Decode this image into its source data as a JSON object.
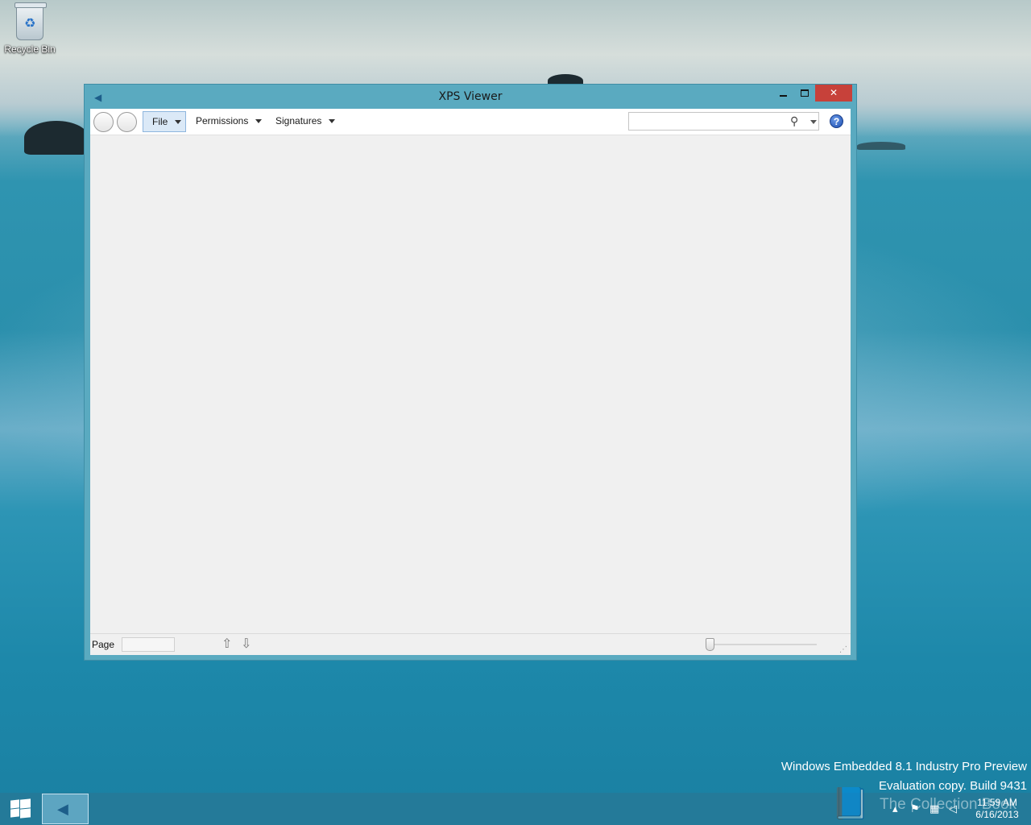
{
  "desktop": {
    "icons": [
      {
        "label": "Recycle Bin",
        "icon": "recycle-bin-icon"
      }
    ],
    "watermark": {
      "line1": "Windows Embedded 8.1 Industry Pro Preview",
      "line2": "Evaluation copy. Build 9431"
    },
    "brand_overlay": "The Collection Book"
  },
  "window": {
    "title": "XPS Viewer",
    "controls": {
      "minimize": "minimize-icon",
      "maximize": "maximize-icon",
      "close": "✕"
    },
    "toolbar": {
      "menus": [
        {
          "label": "File",
          "active": true
        },
        {
          "label": "Permissions"
        },
        {
          "label": "Signatures"
        }
      ],
      "search": {
        "value": "",
        "placeholder": ""
      },
      "help_label": "?"
    },
    "statusbar": {
      "page_label": "Page",
      "page_value": "",
      "up_icon": "⇧",
      "down_icon": "⇩"
    }
  },
  "taskbar": {
    "clock": {
      "time": "11:59 AM",
      "date": "6/16/2013"
    },
    "tray_icons": [
      "show-hidden-icons-icon",
      "action-center-flag-icon",
      "network-icon",
      "volume-icon"
    ]
  },
  "colors": {
    "close_button": "#c7413a",
    "window_frame": "#5aaac0",
    "file_menu_highlight": "#dbe9f7",
    "help_blue": "#1d4fb0"
  }
}
